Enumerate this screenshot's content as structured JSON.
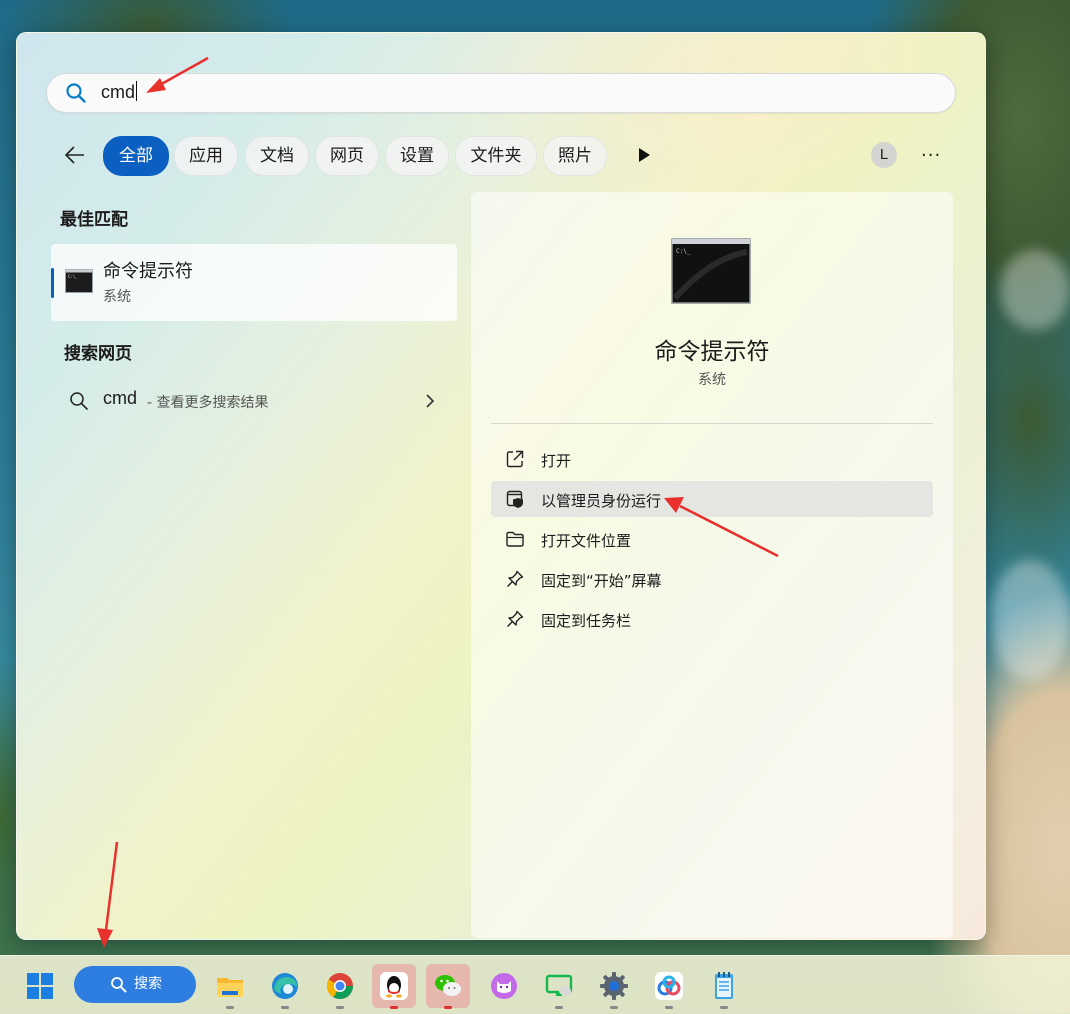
{
  "search": {
    "value": "cmd"
  },
  "filters": [
    "全部",
    "应用",
    "文档",
    "网页",
    "设置",
    "文件夹",
    "照片"
  ],
  "account_initial": "L",
  "more_label": "···",
  "best_match": {
    "title": "最佳匹配",
    "name": "命令提示符",
    "type": "系统"
  },
  "web_search": {
    "title": "搜索网页",
    "query": "cmd",
    "hint": " - 查看更多搜索结果"
  },
  "detail": {
    "name": "命令提示符",
    "type": "系统",
    "actions": [
      "打开",
      "以管理员身份运行",
      "打开文件位置",
      "固定到“开始”屏幕",
      "固定到任务栏"
    ]
  },
  "taskbar": {
    "search_label": "搜索",
    "apps": [
      "start-icon",
      "file-explorer-icon",
      "edge-icon",
      "chrome-icon",
      "qq-icon",
      "wechat-icon",
      "cat-app-icon",
      "remote-desktop-icon",
      "settings-icon",
      "baidu-netdisk-icon",
      "notepad-icon"
    ]
  },
  "colors": {
    "accent": "#0a5fc0",
    "annotation": "#e8302c"
  }
}
